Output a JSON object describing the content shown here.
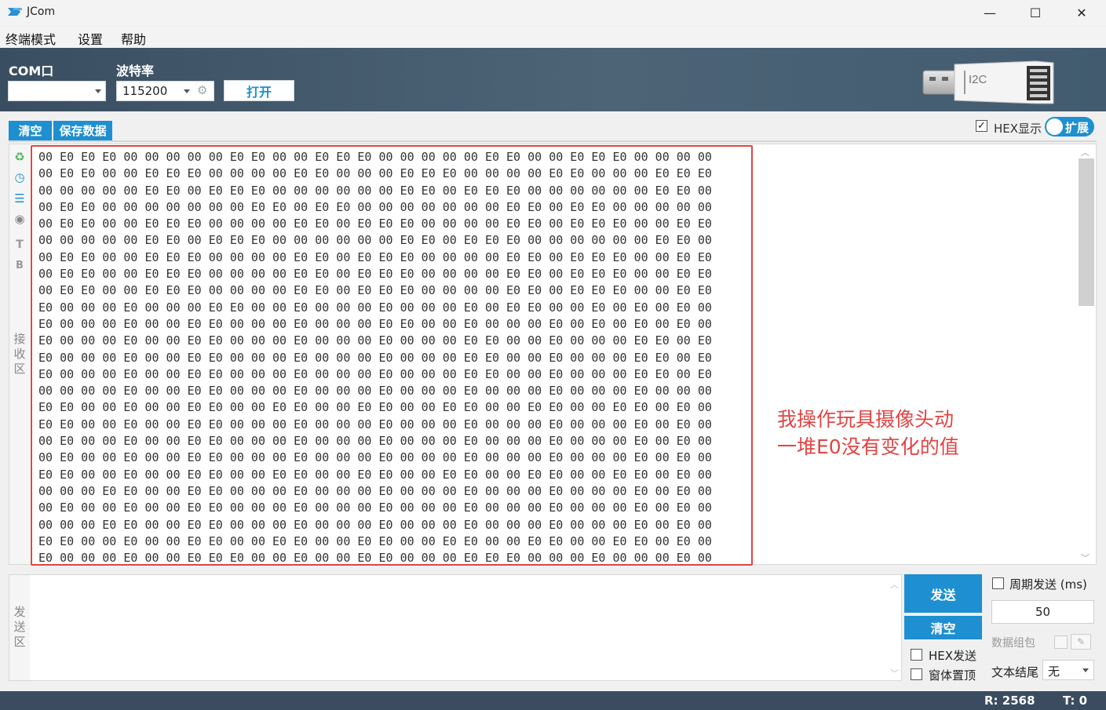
{
  "window": {
    "title": "JCom",
    "minimize_glyph": "—",
    "maximize_glyph": "☐",
    "close_glyph": "✕"
  },
  "menu": [
    "终端模式",
    "设置",
    "帮助"
  ],
  "toolbar": {
    "com_label": "COM口",
    "com_value": "",
    "baud_label": "波特率",
    "baud_value": "115200",
    "open_label": "打开",
    "device_icon": "usb-i2c-adapter",
    "device_text": "I2C"
  },
  "receive": {
    "clear_label": "清空",
    "save_label": "保存数据",
    "hex_display_label": "HEX显示",
    "hex_display_checked": true,
    "expand_label": "扩展",
    "area_label": "接收区",
    "side_icons": [
      "recycle-icon",
      "clock-icon",
      "list-icon",
      "eye-icon"
    ],
    "text_mode": "T",
    "binary_mode": "B",
    "hex_lines": [
      "00 E0 E0 E0 00 00 00 00 00 E0 E0 00 00 E0 E0 E0 00 00 00 00 00 E0 E0 00 00 E0 E0 E0 00 00 00 00",
      "00 E0 E0 00 00 E0 E0 E0 00 00 00 00 E0 E0 00 00 00 E0 E0 E0 00 00 00 00 E0 E0 00 00 00 E0 E0 E0",
      "00 00 00 00 00 E0 E0 00 E0 E0 E0 00 00 00 00 00 00 E0 E0 00 E0 E0 E0 00 00 00 00 00 00 E0 E0 00",
      "00 E0 E0 00 00 00 00 00 00 00 E0 E0 00 E0 E0 00 00 00 00 00 00 00 E0 E0 00 E0 E0 00 00 00 00 00",
      "00 E0 E0 00 00 E0 E0 E0 00 00 00 00 E0 E0 00 E0 E0 E0 00 00 00 00 E0 E0 00 E0 E0 E0 00 00 E0 E0",
      "00 00 00 00 00 E0 E0 00 E0 E0 E0 00 00 00 00 00 00 E0 E0 00 E0 E0 E0 00 00 00 00 00 00 E0 E0 00",
      "00 E0 E0 00 00 E0 E0 E0 00 00 00 00 E0 E0 00 E0 E0 E0 00 00 00 00 E0 E0 00 E0 E0 E0 00 00 E0 E0",
      "00 E0 E0 00 00 E0 E0 E0 00 00 00 00 E0 E0 00 E0 E0 E0 00 00 00 00 E0 E0 00 E0 E0 E0 00 00 E0 E0",
      "00 E0 E0 00 00 E0 E0 E0 00 00 00 00 E0 E0 00 E0 E0 E0 00 00 00 00 E0 E0 00 E0 E0 E0 00 00 E0 E0",
      "E0 00 00 00 E0 00 00 00 E0 E0 00 00 E0 00 00 00 E0 00 00 00 E0 00 E0 E0 00 00 E0 00 E0 00 E0 00",
      "E0 00 00 00 E0 00 00 E0 E0 00 00 00 E0 00 00 00 E0 E0 00 00 E0 00 00 00 E0 00 E0 00 E0 00 E0 00",
      "E0 00 00 00 E0 00 00 E0 E0 00 00 00 E0 00 00 00 E0 00 00 00 E0 E0 00 00 E0 00 00 00 E0 E0 00 E0",
      "E0 00 00 00 E0 00 00 E0 E0 00 00 00 E0 00 00 00 E0 00 00 00 E0 E0 00 00 E0 00 00 00 E0 E0 00 E0",
      "E0 00 00 00 E0 00 00 E0 E0 00 00 00 E0 00 00 00 E0 00 00 00 E0 E0 00 00 E0 00 00 00 E0 E0 00 E0",
      "00 00 00 00 E0 00 00 E0 E0 00 00 00 E0 00 00 00 E0 00 00 00 E0 00 00 00 E0 00 00 00 E0 00 00 00",
      "E0 E0 00 00 E0 00 00 E0 E0 00 00 E0 E0 00 00 E0 E0 00 00 E0 E0 00 00 E0 E0 00 00 E0 E0 00 E0 00",
      "E0 E0 00 00 E0 00 00 E0 E0 00 00 00 E0 00 00 00 E0 00 00 00 E0 00 00 00 E0 00 00 00 E0 00 E0 00",
      "00 E0 00 00 E0 00 00 E0 E0 00 00 00 E0 00 00 00 E0 00 00 00 E0 00 00 00 E0 00 00 00 E0 00 E0 00",
      "00 E0 00 00 E0 00 00 E0 E0 00 00 00 E0 00 00 00 E0 00 00 00 E0 00 00 00 E0 00 00 00 E0 00 E0 00",
      "E0 E0 00 00 E0 00 00 E0 E0 00 00 E0 E0 00 00 E0 E0 00 00 E0 E0 00 00 E0 E0 00 00 E0 E0 00 E0 00",
      "00 00 00 E0 E0 00 00 E0 E0 00 00 00 E0 00 00 00 E0 00 00 00 E0 00 00 00 E0 00 00 00 E0 00 E0 00",
      "00 E0 00 00 E0 00 00 E0 E0 00 00 00 E0 00 00 00 E0 00 00 00 E0 00 00 00 E0 00 00 00 E0 00 E0 00",
      "00 00 00 E0 E0 00 00 E0 E0 00 00 00 E0 00 00 00 E0 00 00 00 E0 00 00 00 E0 00 00 00 E0 00 E0 00",
      "E0 E0 00 00 E0 00 00 E0 E0 00 00 E0 E0 00 00 E0 E0 00 00 E0 E0 00 00 E0 E0 00 00 E0 E0 00 E0 00",
      "E0 00 00 00 E0 00 00 E0 E0 E0 00 00 E0 00 00 E0 E0 00 00 00 E0 E0 E0 00 00 00 E0 00 00 00 E0 00"
    ],
    "annotation_lines": [
      "我操作玩具摄像头动",
      "一堆E0没有变化的值"
    ]
  },
  "send": {
    "area_label": "发送区",
    "input_value": "",
    "send_label": "发送",
    "clear_label": "清空",
    "hex_send_label": "HEX发送",
    "hex_send_checked": false,
    "pin_window_label": "窗体置顶",
    "pin_window_checked": false,
    "periodic_label": "周期发送 (ms)",
    "periodic_checked": false,
    "period_value": "50",
    "packet_label": "数据组包",
    "eol_label": "文本结尾",
    "eol_value": "无"
  },
  "status": {
    "rx": "R: 2568",
    "tx": "T: 0"
  },
  "colors": {
    "accent": "#1e8fd1",
    "toolbar_bg": "#455b6f",
    "annotation": "#e04545",
    "statusbar_bg": "#3b4c60"
  }
}
